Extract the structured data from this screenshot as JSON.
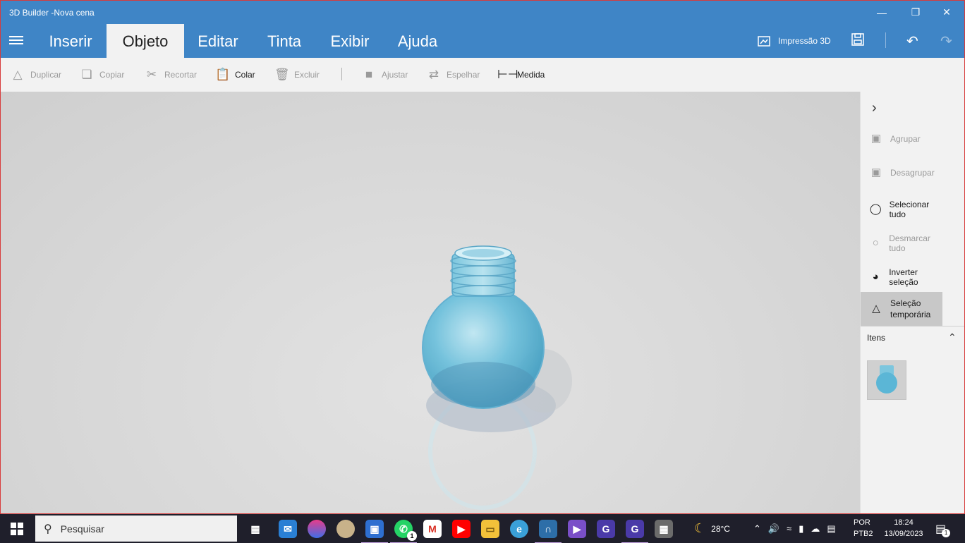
{
  "window": {
    "title": "3D Builder -Nova cena"
  },
  "tabs": [
    {
      "label": "Inserir"
    },
    {
      "label": "Objeto"
    },
    {
      "label": "Editar"
    },
    {
      "label": "Tinta"
    },
    {
      "label": "Exibir"
    },
    {
      "label": "Ajuda"
    }
  ],
  "header": {
    "print3d_label": "Impressão 3D"
  },
  "toolbar": {
    "duplicar": "Duplicar",
    "copiar": "Copiar",
    "recortar": "Recortar",
    "colar": "Colar",
    "excluir": "Excluir",
    "ajustar": "Ajustar",
    "espelhar": "Espelhar",
    "medida": "Medida"
  },
  "panel": {
    "agrupar": "Agrupar",
    "desagrupar": "Desagrupar",
    "selecionar_tudo": "Selecionar tudo",
    "desmarcar_tudo": "Desmarcar tudo",
    "inverter_selecao": "Inverter seleção",
    "selecao_temporaria": "Seleção temporária",
    "items_label": "Itens"
  },
  "taskbar": {
    "search_placeholder": "Pesquisar",
    "weather": "28°C",
    "lang_line1": "POR",
    "lang_line2": "PTB2",
    "time": "18:24",
    "date": "13/09/2023",
    "whatsapp_badge": "1",
    "notification_count": "1"
  },
  "colors": {
    "accent": "#3f85c6",
    "toolbar_bg": "#f2f2f2",
    "bottle": "#5bb6d6",
    "taskbar_bg": "#1f1f2b"
  }
}
